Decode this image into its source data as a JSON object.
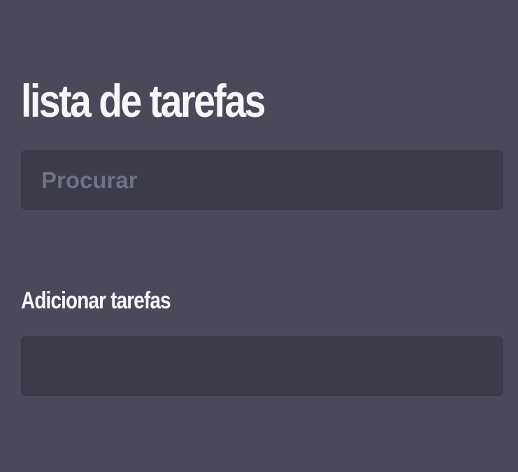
{
  "header": {
    "title": "lista de tarefas"
  },
  "search": {
    "placeholder": "Procurar",
    "value": ""
  },
  "add_task": {
    "label": "Adicionar tarefas",
    "value": "",
    "placeholder": ""
  },
  "colors": {
    "background": "#4b4859",
    "input_background": "#3d3a4a",
    "text": "#f7f7fb",
    "placeholder": "#6c7482"
  }
}
